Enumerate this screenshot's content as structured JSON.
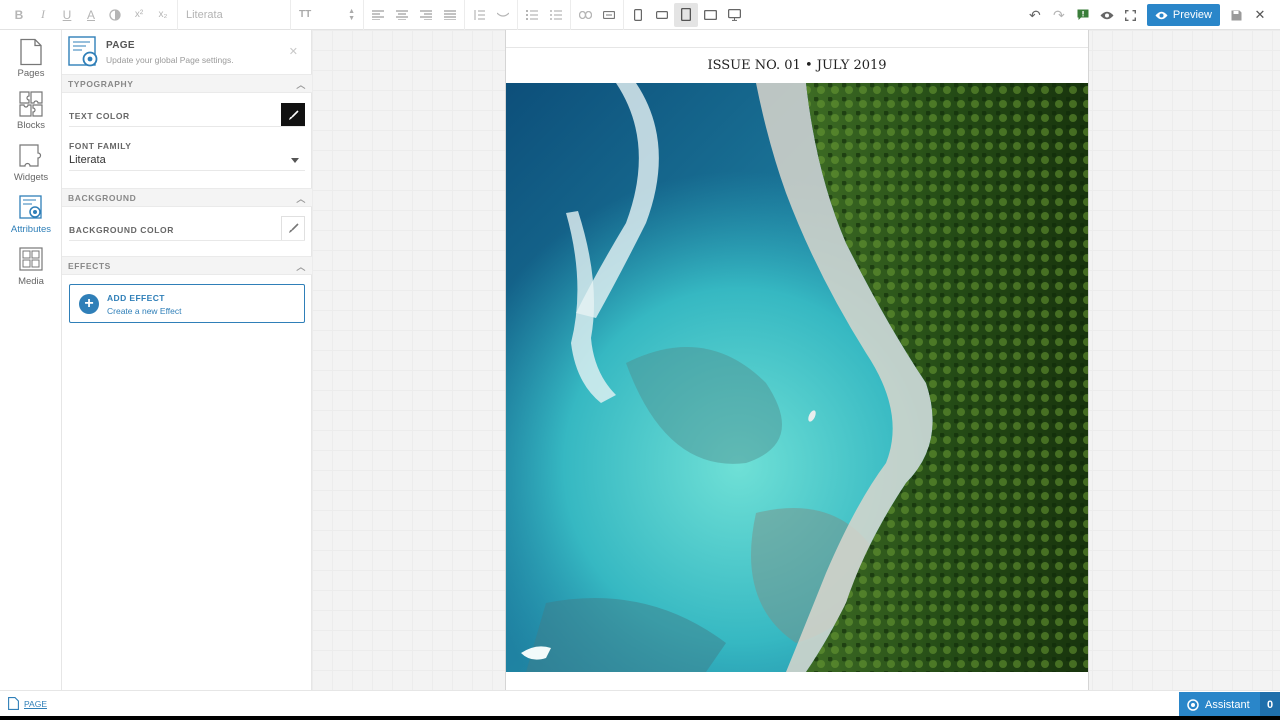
{
  "toolbar": {
    "bold": "B",
    "italic": "I",
    "underline": "U",
    "font_color": "A",
    "superscript": "x²",
    "subscript": "x₂",
    "font_family": "Literata",
    "size_icon": "TT",
    "preview_label": "Preview",
    "accent_color": "#2a86c9"
  },
  "rail": {
    "items": [
      {
        "label": "Pages",
        "icon": "pages-icon"
      },
      {
        "label": "Blocks",
        "icon": "blocks-icon"
      },
      {
        "label": "Widgets",
        "icon": "widgets-icon"
      },
      {
        "label": "Attributes",
        "icon": "attributes-icon",
        "active": true
      },
      {
        "label": "Media",
        "icon": "media-icon"
      }
    ]
  },
  "panel": {
    "title": "PAGE",
    "subtitle": "Update your global Page settings.",
    "sections": {
      "typography": "TYPOGRAPHY",
      "background": "BACKGROUND",
      "effects": "EFFECTS"
    },
    "text_color_label": "TEXT COLOR",
    "text_color_value": "#111111",
    "font_family_label": "FONT FAMILY",
    "font_family_value": "Literata",
    "background_color_label": "BACKGROUND COLOR",
    "add_effect_title": "ADD EFFECT",
    "add_effect_sub": "Create a new Effect"
  },
  "page": {
    "header": "ISSUE NO. 01 • JULY 2019"
  },
  "bottom": {
    "breadcrumb": "PAGE",
    "assistant_label": "Assistant",
    "assistant_count": "0"
  }
}
